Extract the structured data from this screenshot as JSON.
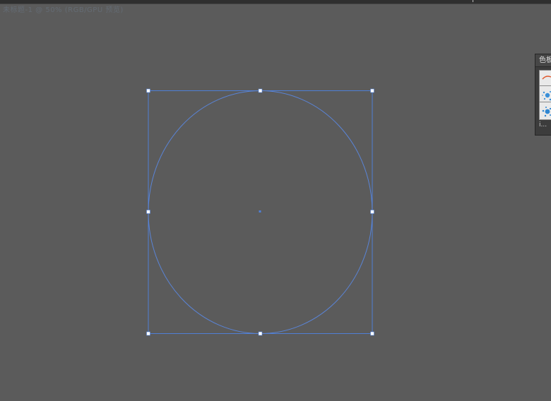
{
  "window": {
    "top_tab_text": "未标题-1 @ 50% (RGB/GPU 预览)"
  },
  "colors": {
    "canvas_bg": "#5b5b5b",
    "selection": "#4f7fd6",
    "ellipse_stroke": "#5a84d6",
    "handle_fill": "#ffffff",
    "panel_bg": "#3c3c3c",
    "brush_orange": "#e0562a",
    "brush_blue": "#3a8fd8"
  },
  "panel": {
    "tab_label": "色板",
    "footer_label": "ⅰ...",
    "swatches": [
      {
        "name": "calligraphic-brush",
        "icon": "brush-stroke-icon"
      },
      {
        "name": "scatter-brush-1",
        "icon": "splatter-icon"
      },
      {
        "name": "scatter-brush-2",
        "icon": "splatter-icon"
      }
    ]
  },
  "selection": {
    "object_type": "ellipse",
    "handles": 8,
    "center_point": true
  }
}
